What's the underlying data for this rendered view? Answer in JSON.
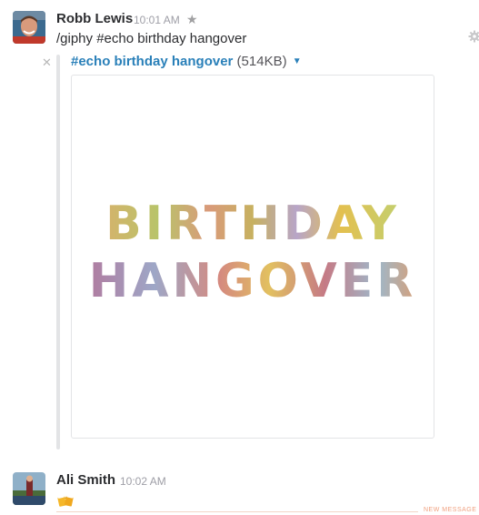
{
  "messages": [
    {
      "sender": "Robb Lewis",
      "time": "10:01 AM",
      "text": "/giphy #echo birthday hangover",
      "attachment": {
        "title": "#echo birthday hangover",
        "size": "(514KB)",
        "image_text_line1": "BIRTHDAY",
        "image_text_line2": "HANGOVER"
      }
    },
    {
      "sender": "Ali Smith",
      "time": "10:02 AM",
      "emoji": "beers-emoji"
    }
  ],
  "divider": {
    "label": "NEW MESSAGE"
  },
  "icons": {
    "star": "star-icon",
    "gear": "gear-icon",
    "close": "close-icon",
    "caret": "caret-down-icon"
  },
  "colors": {
    "link": "#2a80b9",
    "timestamp": "#9e9ea6",
    "new_message": "#f0a07f"
  }
}
